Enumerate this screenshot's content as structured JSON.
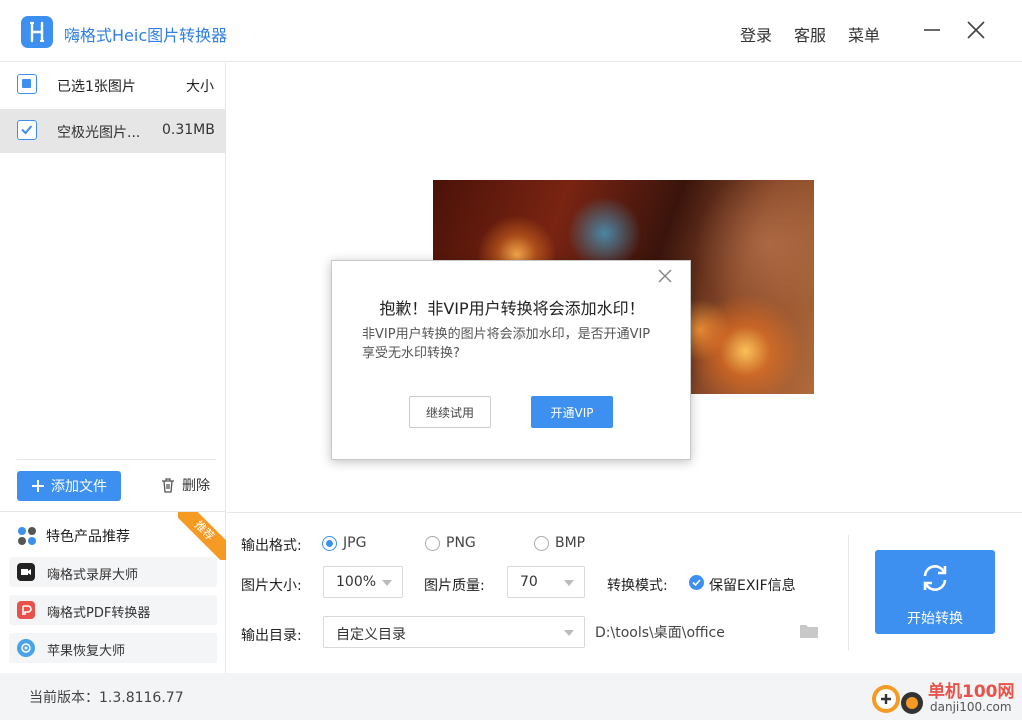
{
  "app": {
    "title": "嗨格式Heic图片转换器"
  },
  "header": {
    "login": "登录",
    "service": "客服",
    "menu": "菜单"
  },
  "filelist": {
    "select_label": "已选1张图片",
    "size_header": "大小",
    "items": [
      {
        "name": "空极光图片...",
        "size": "0.31MB"
      }
    ]
  },
  "actions": {
    "add_label": "添加文件",
    "delete_label": "删除"
  },
  "recommend": {
    "title": "特色产品推荐",
    "badge": "推荐",
    "items": [
      {
        "label": "嗨格式录屏大师",
        "icon": "screen-recorder-icon"
      },
      {
        "label": "嗨格式PDF转换器",
        "icon": "pdf-icon"
      },
      {
        "label": "苹果恢复大师",
        "icon": "apple-recovery-icon"
      }
    ]
  },
  "settings": {
    "format_label": "输出格式:",
    "formats": [
      "JPG",
      "PNG",
      "BMP"
    ],
    "selected_format": "JPG",
    "size_label": "图片大小:",
    "size_value": "100%",
    "quality_label": "图片质量:",
    "quality_value": "70",
    "mode_label": "转换模式:",
    "exif_label": "保留EXIF信息",
    "outdir_label": "输出目录:",
    "outdir_value": "自定义目录",
    "outdir_path": "D:\\tools\\桌面\\office",
    "start_label": "开始转换"
  },
  "footer": {
    "version": "当前版本：1.3.8116.77",
    "watermark_cn": "单机100网",
    "watermark_en": "danji100.com"
  },
  "dialog": {
    "title": "抱歉！非VIP用户转换将会添加水印！",
    "message": "非VIP用户转换的图片将会添加水印，是否开通VIP享受无水印转换?",
    "continue_label": "继续试用",
    "vip_label": "开通VIP"
  },
  "colors": {
    "accent": "#3d8ff0",
    "badge": "#f59a23"
  }
}
